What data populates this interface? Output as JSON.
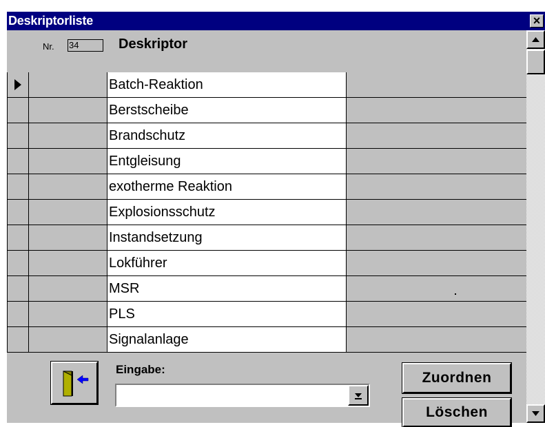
{
  "window": {
    "title": "Deskriptorliste",
    "close_label": "×"
  },
  "header": {
    "nr_label": "Nr.",
    "nr_value": "34",
    "column_title": "Deskriptor"
  },
  "rows": [
    {
      "label": "Batch-Reaktion",
      "selected": true
    },
    {
      "label": "Berstscheibe"
    },
    {
      "label": "Brandschutz"
    },
    {
      "label": "Entgleisung"
    },
    {
      "label": "exotherme Reaktion"
    },
    {
      "label": "Explosionsschutz"
    },
    {
      "label": "Instandsetzung"
    },
    {
      "label": "Lokführer"
    },
    {
      "label": "MSR"
    },
    {
      "label": "PLS"
    },
    {
      "label": "Signalanlage"
    }
  ],
  "footer": {
    "eingabe_label": "Eingabe:",
    "eingabe_value": "",
    "exit_icon": "exit-door-icon",
    "zuordnen_label": "Zuordnen",
    "loeschen_label": "Löschen"
  },
  "colors": {
    "titlebar": "#000080",
    "face": "#c0c0c0",
    "cell": "#ffffff",
    "exit_icon_arrow": "#0000ff",
    "exit_icon_door": "#808000"
  }
}
